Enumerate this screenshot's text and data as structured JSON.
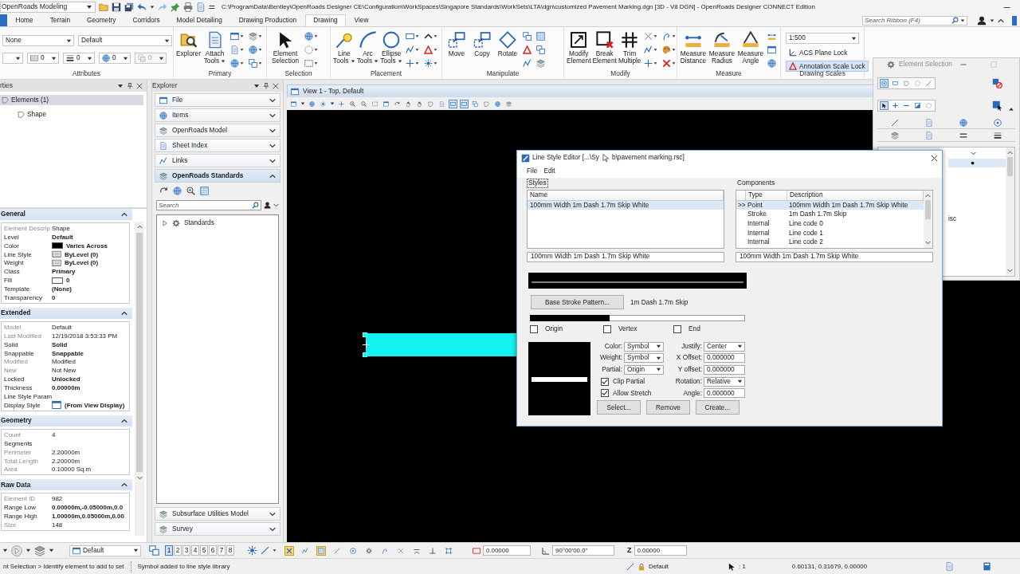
{
  "title_bar": {
    "workflow": "OpenRoads Modeling",
    "title": "C:\\ProgramData\\Bentley\\OpenRoads Designer CE\\Configuration\\WorkSpaces\\Singapore Standards\\WorkSets\\LTA\\dgn\\customized Pavement Marking.dgn [3D - V8 DGN] - OpenRoads Designer CONNECT Edition"
  },
  "ribbon": {
    "tabs": [
      {
        "label": "Home",
        "selected": false
      },
      {
        "label": "Terrain",
        "selected": false
      },
      {
        "label": "Geometry",
        "selected": false
      },
      {
        "label": "Corridors",
        "selected": false
      },
      {
        "label": "Model Detailing",
        "selected": false
      },
      {
        "label": "Drawing Production",
        "selected": false
      },
      {
        "label": "Drawing",
        "selected": true
      },
      {
        "label": "View",
        "selected": false
      }
    ],
    "search": {
      "placeholder": "Search Ribbon (F4)"
    },
    "groups": [
      {
        "kind": "attributes",
        "label": "Attributes",
        "combos": [
          {
            "value": "None"
          },
          {
            "value": "Default"
          }
        ],
        "small_combos": [
          {
            "value": "0",
            "disabled": false
          },
          {
            "value": "0",
            "disabled": false
          },
          {
            "value": "0",
            "disabled": false
          },
          {
            "value": "0",
            "disabled": true
          }
        ]
      },
      {
        "kind": "tools",
        "label": "Primary",
        "tools": [
          {
            "label": "Explorer",
            "dropdown": false
          },
          {
            "label": "Attach Tools",
            "dropdown": true
          }
        ]
      },
      {
        "kind": "tools",
        "label": "Selection",
        "tools": [
          {
            "label": "Element Selection",
            "dropdown": false
          }
        ]
      },
      {
        "kind": "tools",
        "label": "Placement",
        "tools": [
          {
            "label": "Line Tools",
            "dropdown": true
          },
          {
            "label": "Arc Tools",
            "dropdown": true
          },
          {
            "label": "Ellipse Tools",
            "dropdown": true
          }
        ]
      },
      {
        "kind": "tools",
        "label": "Manipulate",
        "tools": [
          {
            "label": "Move",
            "dropdown": false
          },
          {
            "label": "Copy",
            "dropdown": false
          },
          {
            "label": "Rotate",
            "dropdown": false
          }
        ]
      },
      {
        "kind": "tools",
        "label": "Modify",
        "tools": [
          {
            "label": "Modify Element",
            "dropdown": false
          },
          {
            "label": "Break Element",
            "dropdown": false
          },
          {
            "label": "Trim Multiple",
            "dropdown": false
          }
        ]
      },
      {
        "kind": "tools",
        "label": "Measure",
        "tools": [
          {
            "label": "Measure Distance",
            "dropdown": false
          },
          {
            "label": "Measure Radius",
            "dropdown": false
          },
          {
            "label": "Measure Angle",
            "dropdown": false
          }
        ]
      },
      {
        "kind": "scales",
        "label": "Drawing Scales",
        "scale": "1:500",
        "toggles": [
          {
            "label": "ACS Plane Lock",
            "on": false
          },
          {
            "label": "Annotation Scale Lock",
            "on": true
          }
        ]
      }
    ]
  },
  "properties": {
    "title": "rties",
    "tree": [
      {
        "label": "Elements (1)",
        "selected": true,
        "children": [
          {
            "label": "Shape",
            "selected": false
          }
        ]
      }
    ],
    "sections": [
      {
        "title": "General",
        "expanded": true,
        "rows": [
          {
            "label": "Element Descrip",
            "value": "Shape",
            "kind": "text",
            "read_only": true
          },
          {
            "label": "Level",
            "value": "Default",
            "kind": "text",
            "read_only": false
          },
          {
            "label": "Color",
            "value": "Varies Across",
            "kind": "swatch",
            "color": "#000000",
            "read_only": false
          },
          {
            "label": "Line Style",
            "value": "ByLevel (0)",
            "kind": "pattern",
            "read_only": false
          },
          {
            "label": "Weight",
            "value": "ByLevel (0)",
            "kind": "pattern",
            "read_only": false
          },
          {
            "label": "Class",
            "value": "Primary",
            "kind": "text",
            "read_only": false
          },
          {
            "label": "Fill",
            "value": "0",
            "kind": "swatch",
            "color": "#ffffff",
            "read_only": false
          },
          {
            "label": "Template",
            "value": "(None)",
            "kind": "text",
            "read_only": false
          },
          {
            "label": "Transparency",
            "value": "0",
            "kind": "text",
            "read_only": false
          }
        ]
      },
      {
        "title": "Extended",
        "expanded": true,
        "rows": [
          {
            "label": "Model",
            "value": "Default",
            "kind": "text",
            "read_only": true
          },
          {
            "label": "Last Modified",
            "value": "12/19/2018 3:53:33 PM",
            "kind": "text",
            "read_only": true
          },
          {
            "label": "Solid",
            "value": "Solid",
            "kind": "text",
            "read_only": false
          },
          {
            "label": "Snappable",
            "value": "Snappable",
            "kind": "text",
            "read_only": false
          },
          {
            "label": "Modified",
            "value": "Modified",
            "kind": "text",
            "read_only": true
          },
          {
            "label": "New",
            "value": "Not New",
            "kind": "text",
            "read_only": true
          },
          {
            "label": "Locked",
            "value": "Unlocked",
            "kind": "text",
            "read_only": false
          },
          {
            "label": "Thickness",
            "value": "0.00000m",
            "kind": "text",
            "read_only": false
          },
          {
            "label": "Line Style Param",
            "kind": "text",
            "read_only": false
          },
          {
            "label": "Display Style",
            "value": "(From View Display)",
            "kind": "display",
            "read_only": false
          }
        ]
      },
      {
        "title": "Geometry",
        "expanded": true,
        "rows": [
          {
            "label": "Count",
            "value": "4",
            "kind": "text",
            "read_only": true
          },
          {
            "label": "Segments",
            "kind": "text",
            "read_only": false
          },
          {
            "label": "Perimeter",
            "value": "2.20000m",
            "kind": "text",
            "read_only": true
          },
          {
            "label": "Total Length",
            "value": "2.20000m",
            "kind": "text",
            "read_only": true
          },
          {
            "label": "Area",
            "value": "0.10000 Sq.m",
            "kind": "text",
            "read_only": true
          }
        ]
      },
      {
        "title": "Raw Data",
        "expanded": true,
        "rows": [
          {
            "label": "Element ID",
            "value": "982",
            "kind": "text",
            "read_only": true
          },
          {
            "label": "Range Low",
            "value": "0.00000m,-0.05000m,0.0",
            "kind": "text",
            "read_only": false
          },
          {
            "label": "Range High",
            "value": "1.00000m,0.05000m,0.00",
            "kind": "text",
            "read_only": false
          },
          {
            "label": "Size",
            "value": "148",
            "kind": "text",
            "read_only": true
          }
        ]
      }
    ]
  },
  "explorer": {
    "title": "Explorer",
    "sections": [
      {
        "label": "File",
        "expanded": false
      },
      {
        "label": "Items",
        "expanded": false
      },
      {
        "label": "OpenRoads Model",
        "expanded": false
      },
      {
        "label": "Sheet Index",
        "expanded": false
      },
      {
        "label": "Links",
        "expanded": false
      },
      {
        "label": "OpenRoads Standards",
        "expanded": true,
        "search": {
          "placeholder": "Search"
        },
        "tree": [
          {
            "label": "Standards",
            "expanded": false
          }
        ]
      },
      {
        "label": "Subsurface Utilities Model",
        "expanded": false
      },
      {
        "label": "Survey",
        "expanded": false
      }
    ]
  },
  "view": {
    "title": "View 1 - Top, Default",
    "tools": [
      {
        "selected": false
      },
      {
        "selected": false
      },
      {
        "selected": false
      },
      {
        "selected": false
      },
      {
        "selected": false
      },
      {
        "selected": false
      },
      {
        "selected": false
      },
      {
        "selected": false
      },
      {
        "selected": false
      },
      {
        "selected": false
      },
      {
        "selected": false
      },
      {
        "selected": false
      },
      {
        "selected": false
      },
      {
        "selected": true
      },
      {
        "selected": true
      },
      {
        "selected": false
      },
      {
        "selected": false
      },
      {
        "selected": false
      },
      {
        "selected": false
      }
    ]
  },
  "element_selection": {
    "title": "Element Selection",
    "modes": [
      {
        "selected": true
      },
      {
        "selected": false
      },
      {
        "selected": false
      },
      {
        "selected": false
      },
      {
        "selected": false
      }
    ],
    "methods": [
      {
        "selected": true
      },
      {
        "selected": false
      },
      {
        "selected": false
      },
      {
        "selected": false
      },
      {
        "selected": false
      }
    ],
    "list_text": "isc"
  },
  "line_style_editor": {
    "title_start": "Line Style Editor [...\\Sy",
    "title_end": "b\\pavement marking.rsc]",
    "menu": [
      "File",
      "Edit"
    ],
    "styles": {
      "label": "Styles",
      "columns": [
        "Name"
      ],
      "rows": [
        {
          "name": "100mm Width 1m Dash 1.7m Skip White",
          "selected": true
        }
      ],
      "name_field": "100mm Width 1m Dash 1.7m Skip White"
    },
    "components": {
      "label": "Components",
      "columns": [
        "Type",
        "Description"
      ],
      "rows": [
        {
          "marker": ">>",
          "type": "Point",
          "description": "100mm Width 1m Dash 1.7m Skip White",
          "selected": true
        },
        {
          "type": "Stroke",
          "description": "1m Dash 1.7m Skip",
          "selected": false
        },
        {
          "type": "Internal",
          "description": "Line code 0",
          "selected": false
        },
        {
          "type": "Internal",
          "description": "Line code 1",
          "selected": false
        },
        {
          "type": "Internal",
          "description": "Line code 2",
          "selected": false
        }
      ],
      "name_field": "100mm Width 1m Dash 1.7m Skip White"
    },
    "stroke": {
      "button": "Base Stroke Pattern...",
      "pattern": "1m Dash 1.7m Skip"
    },
    "checkboxes": [
      {
        "label": "Origin",
        "checked": false
      },
      {
        "label": "Vertex",
        "checked": false
      },
      {
        "label": "End",
        "checked": false
      }
    ],
    "left_fields": [
      {
        "label": "Color:",
        "kind": "dropdown",
        "value": "Symbol"
      },
      {
        "label": "Weight:",
        "kind": "dropdown",
        "value": "Symbol"
      },
      {
        "label": "Partial:",
        "kind": "dropdown",
        "value": "Origin"
      },
      {
        "label": "Clip Partial",
        "kind": "checkbox",
        "checked": true
      },
      {
        "label": "Allow Stretch",
        "kind": "checkbox",
        "checked": true
      }
    ],
    "right_fields": [
      {
        "label": "Justify:",
        "kind": "dropdown",
        "value": "Center"
      },
      {
        "label": "X Offset:",
        "kind": "text",
        "value": "0.000000"
      },
      {
        "label": "Y offset:",
        "kind": "text",
        "value": "0.000000"
      },
      {
        "label": "Rotation:",
        "kind": "dropdown",
        "value": "Relative"
      },
      {
        "label": "Angle:",
        "kind": "text",
        "value": "0.000000"
      }
    ],
    "buttons": [
      "Select...",
      "Remove",
      "Create..."
    ]
  },
  "toolbar": {
    "level": "Default",
    "views": [
      {
        "label": "1",
        "selected": true
      },
      {
        "label": "2",
        "selected": false
      },
      {
        "label": "3",
        "selected": false
      },
      {
        "label": "4",
        "selected": false
      },
      {
        "label": "5",
        "selected": false
      },
      {
        "label": "6",
        "selected": false
      },
      {
        "label": "7",
        "selected": false
      },
      {
        "label": "8",
        "selected": false
      }
    ],
    "snaps": [
      {
        "selected": true
      },
      {
        "selected": false
      },
      {
        "selected": true
      },
      {
        "selected": false
      },
      {
        "selected": false
      },
      {
        "selected": false
      },
      {
        "selected": false
      },
      {
        "selected": false
      },
      {
        "selected": false
      },
      {
        "selected": false
      },
      {
        "selected": false
      }
    ],
    "fields": [
      {
        "kind": "distance",
        "value": "0.00000"
      },
      {
        "kind": "angle",
        "value": "90°00'00.0\""
      },
      {
        "kind": "z",
        "label": "Z",
        "value": "0.00000"
      }
    ]
  },
  "status_bar": {
    "prompt": "nt Selection > Identify element to add to set",
    "message": "Symbol added to line style library",
    "level": "Default",
    "selection": ": 1",
    "coordinates": "0.60131, 0.31679, 0.00000"
  }
}
